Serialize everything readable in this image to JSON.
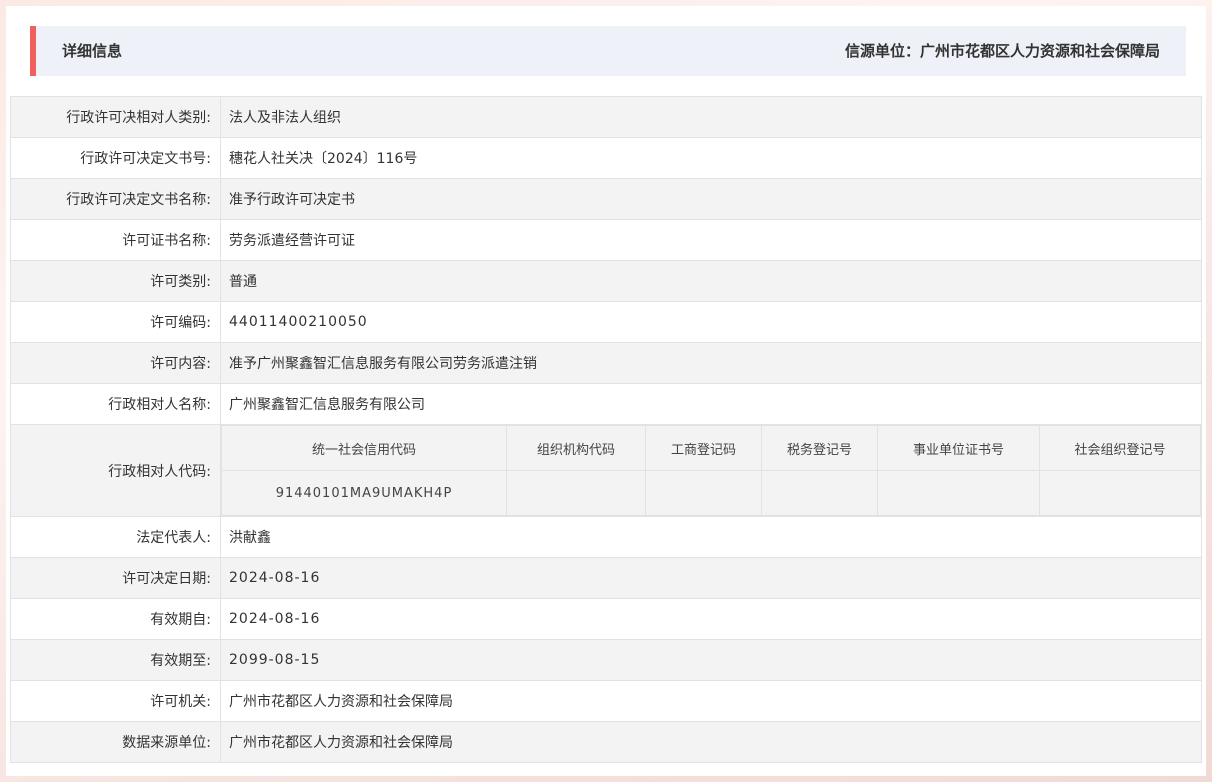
{
  "header": {
    "title": "详细信息",
    "source_label": "信源单位：广州市花都区人力资源和社会保障局"
  },
  "rows": [
    {
      "label": "行政许可决相对人类别:",
      "value": "法人及非法人组织"
    },
    {
      "label": "行政许可决定文书号:",
      "value": "穗花人社关决〔2024〕116号"
    },
    {
      "label": "行政许可决定文书名称:",
      "value": "准予行政许可决定书"
    },
    {
      "label": "许可证书名称:",
      "value": "劳务派遣经营许可证"
    },
    {
      "label": "许可类别:",
      "value": "普通"
    },
    {
      "label": "许可编码:",
      "value": "44011400210050"
    },
    {
      "label": "许可内容:",
      "value": "准予广州聚鑫智汇信息服务有限公司劳务派遣注销"
    },
    {
      "label": "行政相对人名称:",
      "value": "广州聚鑫智汇信息服务有限公司"
    }
  ],
  "codes": {
    "label": "行政相对人代码:",
    "headers": [
      "统一社会信用代码",
      "组织机构代码",
      "工商登记码",
      "税务登记号",
      "事业单位证书号",
      "社会组织登记号"
    ],
    "values": [
      "91440101MA9UMAKH4P",
      "",
      "",
      "",
      "",
      ""
    ]
  },
  "rows2": [
    {
      "label": "法定代表人:",
      "value": "洪献鑫"
    },
    {
      "label": "许可决定日期:",
      "value": "2024-08-16"
    },
    {
      "label": "有效期自:",
      "value": "2024-08-16"
    },
    {
      "label": "有效期至:",
      "value": "2099-08-15"
    },
    {
      "label": "许可机关:",
      "value": "广州市花都区人力资源和社会保障局"
    },
    {
      "label": "数据来源单位:",
      "value": "广州市花都区人力资源和社会保障局"
    }
  ]
}
